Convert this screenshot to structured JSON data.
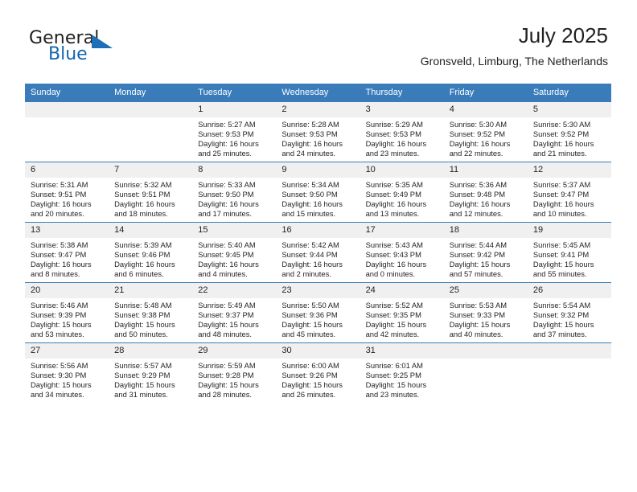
{
  "brand": {
    "name_part1": "General",
    "name_part2": "Blue",
    "triangle_icon": "triangle-icon",
    "accent_color": "#1f6fb8"
  },
  "header": {
    "title": "July 2025",
    "subtitle": "Gronsveld, Limburg, The Netherlands"
  },
  "calendar": {
    "header_bg": "#3a7cba",
    "daynum_bg": "#f0f0f0",
    "weekday_headers": [
      "Sunday",
      "Monday",
      "Tuesday",
      "Wednesday",
      "Thursday",
      "Friday",
      "Saturday"
    ],
    "weeks": [
      [
        {
          "day": "",
          "sunrise": "",
          "sunset": "",
          "daylight1": "",
          "daylight2": ""
        },
        {
          "day": "",
          "sunrise": "",
          "sunset": "",
          "daylight1": "",
          "daylight2": ""
        },
        {
          "day": "1",
          "sunrise": "Sunrise: 5:27 AM",
          "sunset": "Sunset: 9:53 PM",
          "daylight1": "Daylight: 16 hours",
          "daylight2": "and 25 minutes."
        },
        {
          "day": "2",
          "sunrise": "Sunrise: 5:28 AM",
          "sunset": "Sunset: 9:53 PM",
          "daylight1": "Daylight: 16 hours",
          "daylight2": "and 24 minutes."
        },
        {
          "day": "3",
          "sunrise": "Sunrise: 5:29 AM",
          "sunset": "Sunset: 9:53 PM",
          "daylight1": "Daylight: 16 hours",
          "daylight2": "and 23 minutes."
        },
        {
          "day": "4",
          "sunrise": "Sunrise: 5:30 AM",
          "sunset": "Sunset: 9:52 PM",
          "daylight1": "Daylight: 16 hours",
          "daylight2": "and 22 minutes."
        },
        {
          "day": "5",
          "sunrise": "Sunrise: 5:30 AM",
          "sunset": "Sunset: 9:52 PM",
          "daylight1": "Daylight: 16 hours",
          "daylight2": "and 21 minutes."
        }
      ],
      [
        {
          "day": "6",
          "sunrise": "Sunrise: 5:31 AM",
          "sunset": "Sunset: 9:51 PM",
          "daylight1": "Daylight: 16 hours",
          "daylight2": "and 20 minutes."
        },
        {
          "day": "7",
          "sunrise": "Sunrise: 5:32 AM",
          "sunset": "Sunset: 9:51 PM",
          "daylight1": "Daylight: 16 hours",
          "daylight2": "and 18 minutes."
        },
        {
          "day": "8",
          "sunrise": "Sunrise: 5:33 AM",
          "sunset": "Sunset: 9:50 PM",
          "daylight1": "Daylight: 16 hours",
          "daylight2": "and 17 minutes."
        },
        {
          "day": "9",
          "sunrise": "Sunrise: 5:34 AM",
          "sunset": "Sunset: 9:50 PM",
          "daylight1": "Daylight: 16 hours",
          "daylight2": "and 15 minutes."
        },
        {
          "day": "10",
          "sunrise": "Sunrise: 5:35 AM",
          "sunset": "Sunset: 9:49 PM",
          "daylight1": "Daylight: 16 hours",
          "daylight2": "and 13 minutes."
        },
        {
          "day": "11",
          "sunrise": "Sunrise: 5:36 AM",
          "sunset": "Sunset: 9:48 PM",
          "daylight1": "Daylight: 16 hours",
          "daylight2": "and 12 minutes."
        },
        {
          "day": "12",
          "sunrise": "Sunrise: 5:37 AM",
          "sunset": "Sunset: 9:47 PM",
          "daylight1": "Daylight: 16 hours",
          "daylight2": "and 10 minutes."
        }
      ],
      [
        {
          "day": "13",
          "sunrise": "Sunrise: 5:38 AM",
          "sunset": "Sunset: 9:47 PM",
          "daylight1": "Daylight: 16 hours",
          "daylight2": "and 8 minutes."
        },
        {
          "day": "14",
          "sunrise": "Sunrise: 5:39 AM",
          "sunset": "Sunset: 9:46 PM",
          "daylight1": "Daylight: 16 hours",
          "daylight2": "and 6 minutes."
        },
        {
          "day": "15",
          "sunrise": "Sunrise: 5:40 AM",
          "sunset": "Sunset: 9:45 PM",
          "daylight1": "Daylight: 16 hours",
          "daylight2": "and 4 minutes."
        },
        {
          "day": "16",
          "sunrise": "Sunrise: 5:42 AM",
          "sunset": "Sunset: 9:44 PM",
          "daylight1": "Daylight: 16 hours",
          "daylight2": "and 2 minutes."
        },
        {
          "day": "17",
          "sunrise": "Sunrise: 5:43 AM",
          "sunset": "Sunset: 9:43 PM",
          "daylight1": "Daylight: 16 hours",
          "daylight2": "and 0 minutes."
        },
        {
          "day": "18",
          "sunrise": "Sunrise: 5:44 AM",
          "sunset": "Sunset: 9:42 PM",
          "daylight1": "Daylight: 15 hours",
          "daylight2": "and 57 minutes."
        },
        {
          "day": "19",
          "sunrise": "Sunrise: 5:45 AM",
          "sunset": "Sunset: 9:41 PM",
          "daylight1": "Daylight: 15 hours",
          "daylight2": "and 55 minutes."
        }
      ],
      [
        {
          "day": "20",
          "sunrise": "Sunrise: 5:46 AM",
          "sunset": "Sunset: 9:39 PM",
          "daylight1": "Daylight: 15 hours",
          "daylight2": "and 53 minutes."
        },
        {
          "day": "21",
          "sunrise": "Sunrise: 5:48 AM",
          "sunset": "Sunset: 9:38 PM",
          "daylight1": "Daylight: 15 hours",
          "daylight2": "and 50 minutes."
        },
        {
          "day": "22",
          "sunrise": "Sunrise: 5:49 AM",
          "sunset": "Sunset: 9:37 PM",
          "daylight1": "Daylight: 15 hours",
          "daylight2": "and 48 minutes."
        },
        {
          "day": "23",
          "sunrise": "Sunrise: 5:50 AM",
          "sunset": "Sunset: 9:36 PM",
          "daylight1": "Daylight: 15 hours",
          "daylight2": "and 45 minutes."
        },
        {
          "day": "24",
          "sunrise": "Sunrise: 5:52 AM",
          "sunset": "Sunset: 9:35 PM",
          "daylight1": "Daylight: 15 hours",
          "daylight2": "and 42 minutes."
        },
        {
          "day": "25",
          "sunrise": "Sunrise: 5:53 AM",
          "sunset": "Sunset: 9:33 PM",
          "daylight1": "Daylight: 15 hours",
          "daylight2": "and 40 minutes."
        },
        {
          "day": "26",
          "sunrise": "Sunrise: 5:54 AM",
          "sunset": "Sunset: 9:32 PM",
          "daylight1": "Daylight: 15 hours",
          "daylight2": "and 37 minutes."
        }
      ],
      [
        {
          "day": "27",
          "sunrise": "Sunrise: 5:56 AM",
          "sunset": "Sunset: 9:30 PM",
          "daylight1": "Daylight: 15 hours",
          "daylight2": "and 34 minutes."
        },
        {
          "day": "28",
          "sunrise": "Sunrise: 5:57 AM",
          "sunset": "Sunset: 9:29 PM",
          "daylight1": "Daylight: 15 hours",
          "daylight2": "and 31 minutes."
        },
        {
          "day": "29",
          "sunrise": "Sunrise: 5:59 AM",
          "sunset": "Sunset: 9:28 PM",
          "daylight1": "Daylight: 15 hours",
          "daylight2": "and 28 minutes."
        },
        {
          "day": "30",
          "sunrise": "Sunrise: 6:00 AM",
          "sunset": "Sunset: 9:26 PM",
          "daylight1": "Daylight: 15 hours",
          "daylight2": "and 26 minutes."
        },
        {
          "day": "31",
          "sunrise": "Sunrise: 6:01 AM",
          "sunset": "Sunset: 9:25 PM",
          "daylight1": "Daylight: 15 hours",
          "daylight2": "and 23 minutes."
        },
        {
          "day": "",
          "sunrise": "",
          "sunset": "",
          "daylight1": "",
          "daylight2": ""
        },
        {
          "day": "",
          "sunrise": "",
          "sunset": "",
          "daylight1": "",
          "daylight2": ""
        }
      ]
    ]
  }
}
